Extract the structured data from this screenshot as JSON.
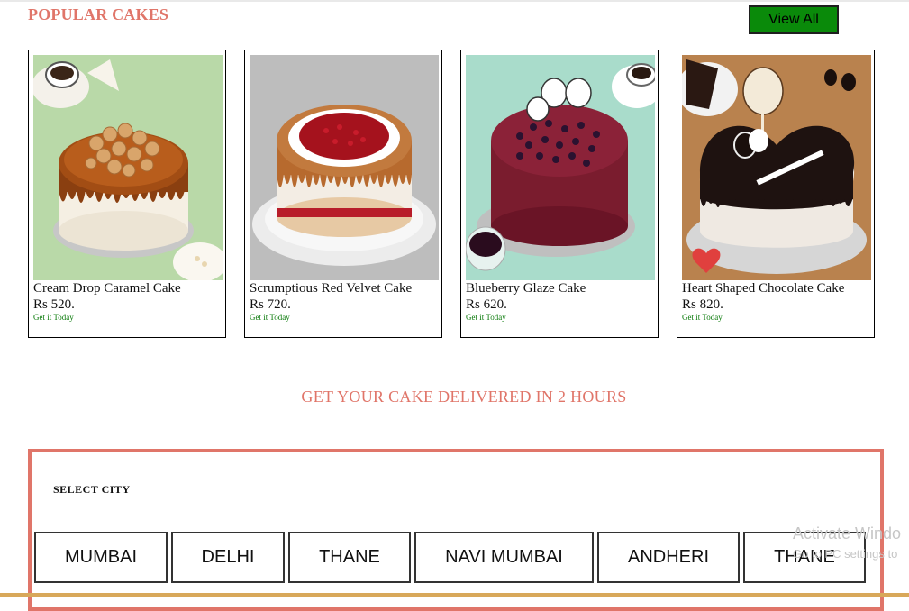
{
  "popular": {
    "title": "POPULAR CAKES",
    "view_all_label": "View All"
  },
  "cards": [
    {
      "name": "Cream Drop Caramel Cake",
      "price": "Rs 520.",
      "delivery": "Get it Today",
      "image_icon": "caramel-cake-photo"
    },
    {
      "name": "Scrumptious Red Velvet Cake",
      "price": "Rs 720.",
      "delivery": "Get it Today",
      "image_icon": "red-velvet-cake-photo"
    },
    {
      "name": "Blueberry Glaze Cake",
      "price": "Rs 620.",
      "delivery": "Get it Today",
      "image_icon": "blueberry-cake-photo"
    },
    {
      "name": "Heart Shaped Chocolate Cake",
      "price": "Rs 820.",
      "delivery": "Get it Today",
      "image_icon": "heart-chocolate-cake-photo"
    }
  ],
  "promo": {
    "headline": "GET YOUR CAKE DELIVERED IN 2 HOURS"
  },
  "city": {
    "label": "SELECT CITY",
    "options": [
      "MUMBAI",
      "DELHI",
      "THANE",
      "NAVI MUMBAI",
      "ANDHERI",
      "THANE"
    ]
  },
  "watermark": {
    "line1": "Activate Windo",
    "line2": "Go to PC settings to"
  },
  "colors": {
    "accent": "#e07569",
    "view_all_bg": "#0a8a0a",
    "delivery_text": "#0a7a0a"
  }
}
